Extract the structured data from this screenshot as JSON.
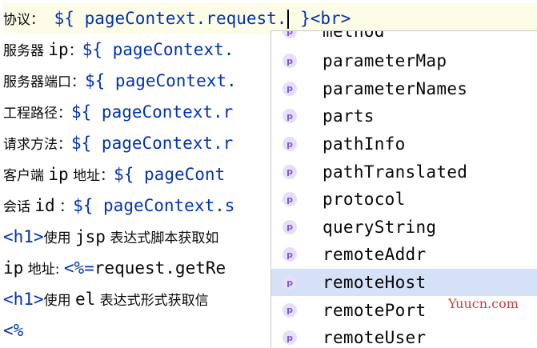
{
  "lines": [
    {
      "cn": "协议：",
      "code": "${ pageContext.request.",
      "after": " }",
      "tag": "<br>"
    },
    {
      "cn": "服务器 ",
      "code2": "ip",
      "cn2": "：",
      "code": "${ pageContext."
    },
    {
      "cn": "服务器端口：",
      "code": "${ pageContext."
    },
    {
      "cn": "工程路径：",
      "code": "${ pageContext.r"
    },
    {
      "cn": "请求方法：",
      "code": "${ pageContext.r"
    },
    {
      "cn": "客户端 ",
      "code2": "ip",
      "cn2": " 地址：",
      "code": "${ pageCont"
    },
    {
      "cn": "会话 ",
      "code2": "id",
      "cn2": " ：",
      "code": "${ pageContext.s"
    },
    {
      "tag": "<h1>",
      "cn": "使用 ",
      "code2": "jsp",
      "cn2": " 表达式脚本获取如"
    },
    {
      "code2": "ip",
      "cn2": " 地址: ",
      "jsp": "<%=",
      "code": "request.getRe"
    },
    {
      "tag": "<h1>",
      "cn": "使用 ",
      "code2": "el",
      "cn2": " 表达式形式获取信"
    },
    {
      "jsp": "<%"
    }
  ],
  "completion": {
    "partial_top": "method",
    "items": [
      "parameterMap",
      "parameterNames",
      "parts",
      "pathInfo",
      "pathTranslated",
      "protocol",
      "queryString",
      "remoteAddr",
      "remoteHost",
      "remotePort",
      "remoteUser"
    ],
    "selected": "remoteHost",
    "badge": "p"
  },
  "watermark": "Yuucn.com"
}
